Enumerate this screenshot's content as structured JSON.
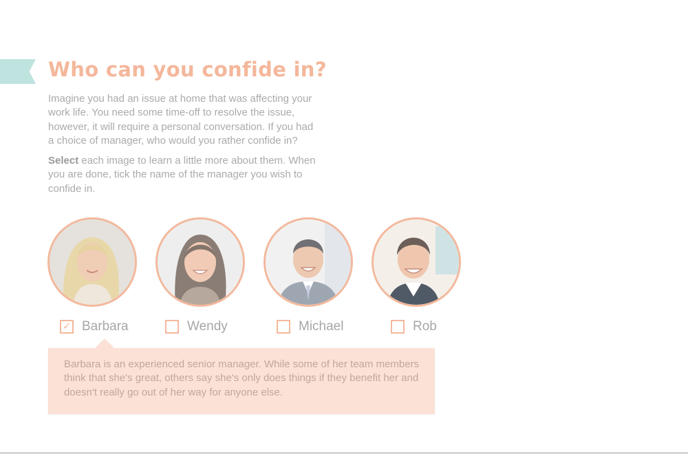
{
  "title": "Who can you confide in?",
  "intro": "Imagine you had an issue at home that was affecting your work life. You need some time-off to resolve the issue, however, it will require a personal conversation. If you had a choice of manager, who would you rather confide in?",
  "instructions": {
    "bold": "Select",
    "rest": " each image to learn a little more about them. When you are done, tick the name of the manager you wish to confide in."
  },
  "managers": [
    {
      "name": "Barbara",
      "checked": true
    },
    {
      "name": "Wendy",
      "checked": false
    },
    {
      "name": "Michael",
      "checked": false
    },
    {
      "name": "Rob",
      "checked": false
    }
  ],
  "info_text": "Barbara is an experienced senior manager. While some of her team members think that she's great, others say she's only does things if they benefit her and doesn't really go out of her way for anyone else.",
  "colors": {
    "accent": "#f3b89c",
    "title": "#f4b79b",
    "ribbon": "#bfe3df",
    "info_bg": "#fbe1d6"
  }
}
